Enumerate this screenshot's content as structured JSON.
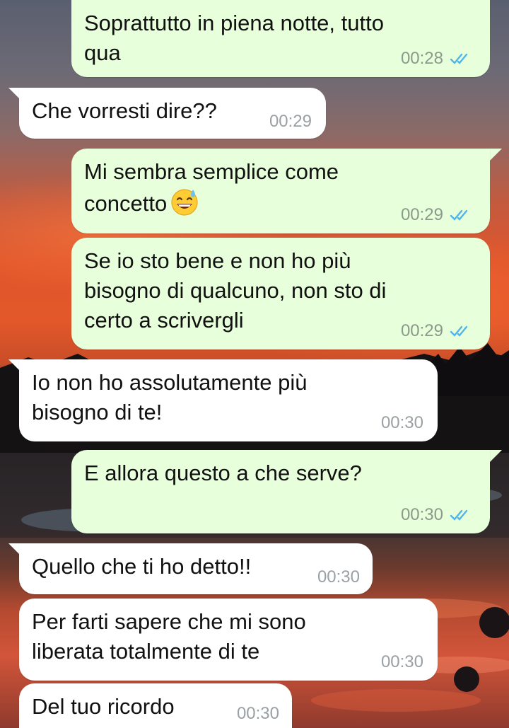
{
  "conversation": {
    "messages": [
      {
        "id": "m1",
        "direction": "outgoing",
        "text": "Soprattutto in piena notte, tutto\nqua",
        "time": "00:28",
        "status": "read-ticks-icon"
      },
      {
        "id": "m2",
        "direction": "incoming",
        "text": "Che vorresti dire??",
        "time": "00:29"
      },
      {
        "id": "m3",
        "direction": "outgoing",
        "text": "Mi sembra semplice come\nconcetto",
        "emoji": "grinning-face-with-sweat-emoji",
        "time": "00:29",
        "status": "read-ticks-icon"
      },
      {
        "id": "m4",
        "direction": "outgoing",
        "text": "Se io sto bene e non ho più\nbisogno di qualcuno, non sto di\ncerto a scrivergli",
        "time": "00:29",
        "status": "read-ticks-icon"
      },
      {
        "id": "m5",
        "direction": "incoming",
        "text": "Io non ho assolutamente più\nbisogno di te!",
        "time": "00:30"
      },
      {
        "id": "m6",
        "direction": "outgoing",
        "text": "E allora questo a che serve?",
        "time": "00:30",
        "status": "read-ticks-icon"
      },
      {
        "id": "m7",
        "direction": "incoming",
        "text": "Quello che ti ho detto!!",
        "time": "00:30"
      },
      {
        "id": "m8",
        "direction": "incoming",
        "text": "Per farti sapere che mi sono\nliberata totalmente di te",
        "time": "00:30"
      },
      {
        "id": "m9",
        "direction": "incoming",
        "text": "Del tuo ricordo",
        "time": "00:30"
      }
    ]
  },
  "colors": {
    "outgoing_bubble": "#e7ffdb",
    "incoming_bubble": "#ffffff",
    "read_ticks": "#4fb6ec",
    "timestamp": "#8b9a8a"
  }
}
